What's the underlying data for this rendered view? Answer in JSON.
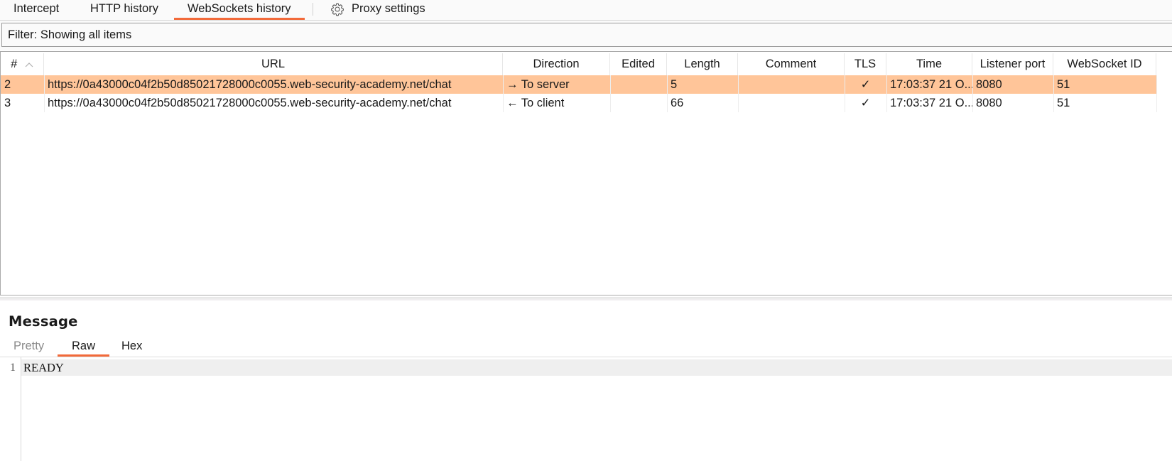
{
  "tabs": {
    "items": [
      {
        "label": "Intercept"
      },
      {
        "label": "HTTP history"
      },
      {
        "label": "WebSockets history"
      }
    ],
    "active": "WebSockets history",
    "settings": {
      "icon": "gear-icon",
      "label": "Proxy settings"
    }
  },
  "filter": {
    "text": "Filter: Showing all items"
  },
  "table": {
    "columns": [
      "#",
      "URL",
      "Direction",
      "Edited",
      "Length",
      "Comment",
      "TLS",
      "Time",
      "Listener port",
      "WebSocket ID"
    ],
    "sort": {
      "column": "#",
      "direction": "ascending",
      "icon": "chevron-up-icon"
    },
    "rows": [
      {
        "num": "2",
        "url": "https://0a43000c04f2b50d85021728000c0055.web-security-academy.net/chat",
        "direction": "→ To server",
        "edited": "",
        "length": "5",
        "comment": "",
        "tls": "✓",
        "time": "17:03:37 21 O...",
        "port": "8080",
        "ws_id": "51",
        "selected": true
      },
      {
        "num": "3",
        "url": "https://0a43000c04f2b50d85021728000c0055.web-security-academy.net/chat",
        "direction": "← To client",
        "edited": "",
        "length": "66",
        "comment": "",
        "tls": "✓",
        "time": "17:03:37 21 O...",
        "port": "8080",
        "ws_id": "51",
        "selected": false
      }
    ]
  },
  "message": {
    "title": "Message",
    "tabs": [
      {
        "label": "Pretty"
      },
      {
        "label": "Raw"
      },
      {
        "label": "Hex"
      }
    ],
    "active_tab": "Raw",
    "lines": [
      {
        "number": "1",
        "text": "READY"
      }
    ]
  },
  "colors": {
    "accent": "#f26a3a",
    "selected_row": "#ffc599"
  }
}
